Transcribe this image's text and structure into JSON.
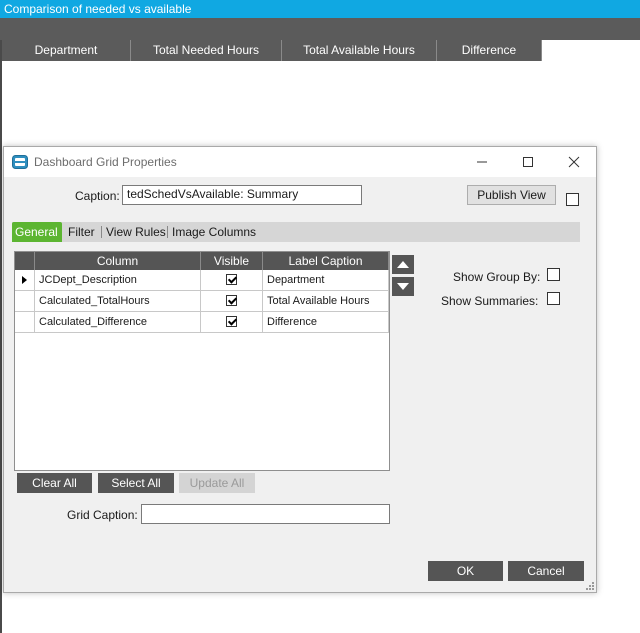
{
  "background": {
    "title": "Comparison of needed vs available",
    "columns": [
      "Department",
      "Total Needed Hours",
      "Total Available Hours",
      "Difference"
    ]
  },
  "dialog": {
    "title": "Dashboard Grid Properties",
    "caption_label": "Caption:",
    "caption_value": "tedSchedVsAvailable: Summary",
    "publish_view_label": "Publish View",
    "tabs": [
      {
        "label": "General",
        "active": true
      },
      {
        "label": "Filter",
        "active": false
      },
      {
        "label": "View Rules",
        "active": false
      },
      {
        "label": "Image Columns",
        "active": false
      }
    ],
    "grid": {
      "headers": {
        "column": "Column",
        "visible": "Visible",
        "label_caption": "Label Caption"
      },
      "rows": [
        {
          "column": "JCDept_Description",
          "visible": true,
          "label_caption": "Department"
        },
        {
          "column": "Calculated_TotalHours",
          "visible": true,
          "label_caption": "Total Available Hours"
        },
        {
          "column": "Calculated_Difference",
          "visible": true,
          "label_caption": "Difference"
        }
      ]
    },
    "show_group_by_label": "Show Group By:",
    "show_summaries_label": "Show Summaries:",
    "clear_all_label": "Clear All",
    "select_all_label": "Select All",
    "update_all_label": "Update All",
    "grid_caption_label": "Grid Caption:",
    "grid_caption_value": "",
    "ok_label": "OK",
    "cancel_label": "Cancel"
  },
  "colors": {
    "title_bar": "#10a8e2",
    "dark_header": "#555555",
    "active_tab": "#5cb531"
  },
  "icons": [
    "app-icon",
    "minimize-icon",
    "maximize-icon",
    "close-icon",
    "row-pointer-icon",
    "arrow-up-icon",
    "arrow-down-icon",
    "resize-grip-icon"
  ]
}
